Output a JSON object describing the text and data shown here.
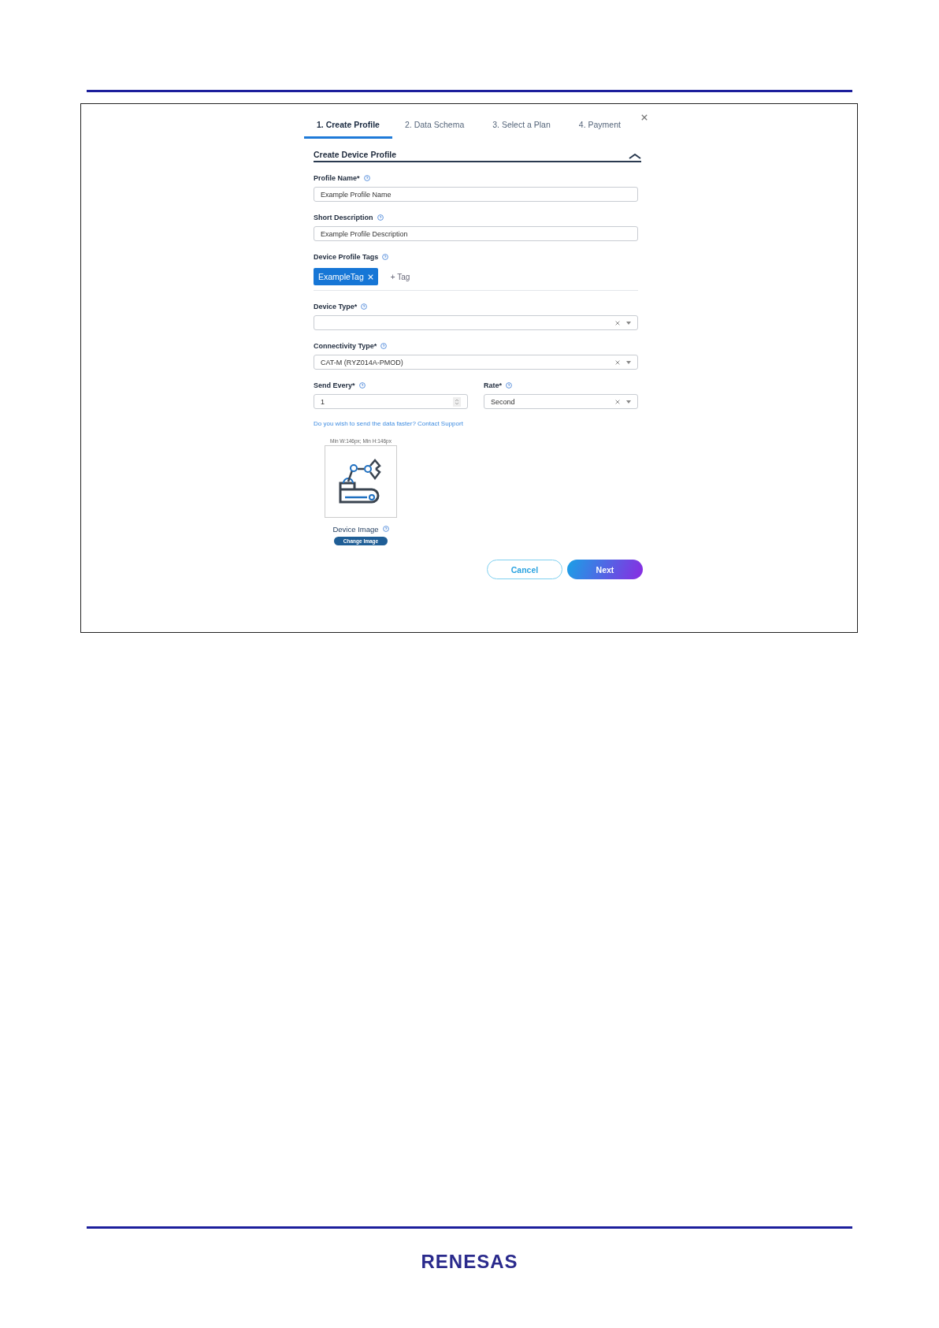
{
  "tabs": [
    {
      "label": "1. Create Profile",
      "selected": true
    },
    {
      "label": "2. Data Schema",
      "selected": false
    },
    {
      "label": "3. Select a Plan",
      "selected": false
    },
    {
      "label": "4. Payment",
      "selected": false
    }
  ],
  "section": {
    "title": "Create Device Profile",
    "expanded": true
  },
  "fields": [
    {
      "kind": "text",
      "label": "Profile Name*",
      "value": "Example Profile Name"
    },
    {
      "kind": "text",
      "label": "Short Description",
      "value": "Example Profile Description"
    },
    {
      "kind": "tags",
      "label": "Device Profile Tags",
      "tags": [
        "ExampleTag"
      ],
      "add_label": "+ Tag"
    },
    {
      "kind": "select",
      "label": "Device Type*"
    },
    {
      "kind": "select",
      "label": "Connectivity Type*",
      "value": "CAT-M (RYZ014A-PMOD)"
    },
    {
      "kind": "pair",
      "items": [
        {
          "kind": "number",
          "label": "Send Every*",
          "value": "1"
        },
        {
          "kind": "select",
          "label": "Rate*",
          "value": "Second"
        }
      ]
    }
  ],
  "support_link": "Do you wish to send the data faster? Contact Support",
  "image": {
    "hint": "Min W:146px; Min H:146px",
    "label": "Device Image",
    "button": "Change Image"
  },
  "buttons": [
    {
      "kind": "secondary",
      "label": "Cancel"
    },
    {
      "kind": "primary",
      "label": "Next"
    }
  ],
  "footer": {
    "logo": "RENESAS"
  }
}
